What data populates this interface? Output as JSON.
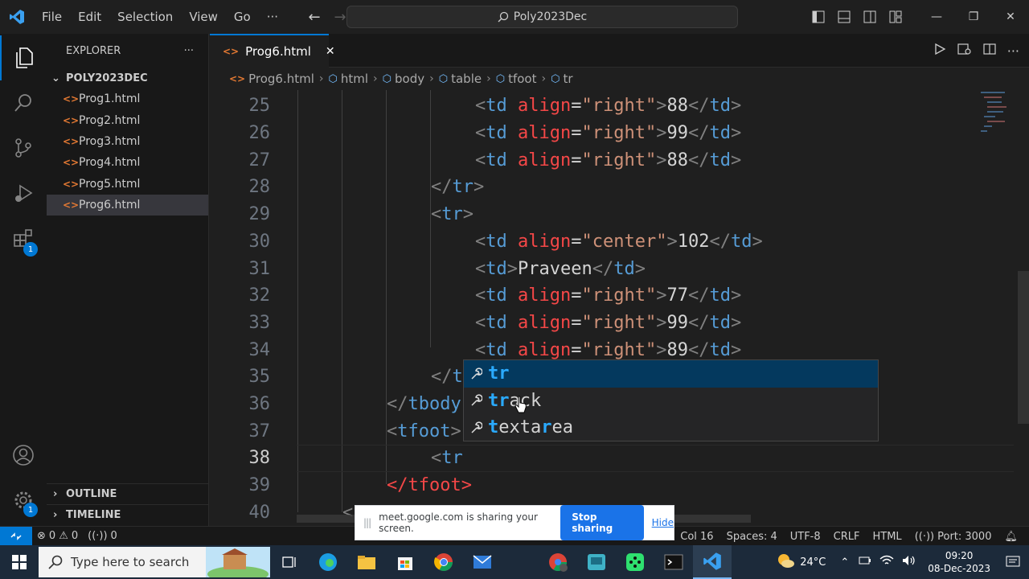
{
  "titlebar": {
    "menu": [
      "File",
      "Edit",
      "Selection",
      "View",
      "Go",
      "···"
    ],
    "search_text": "Poly2023Dec"
  },
  "sidebar": {
    "title": "EXPLORER",
    "more": "···",
    "folder": "POLY2023DEC",
    "files": [
      "Prog1.html",
      "Prog2.html",
      "Prog3.html",
      "Prog4.html",
      "Prog5.html",
      "Prog6.html"
    ],
    "selected_file": "Prog6.html",
    "outline": "OUTLINE",
    "timeline": "TIMELINE"
  },
  "activity": {
    "extensions_badge": "1",
    "settings_badge": "1"
  },
  "tab": {
    "label": "Prog6.html",
    "close": "✕"
  },
  "breadcrumb": [
    "Prog6.html",
    "html",
    "body",
    "table",
    "tfoot",
    "tr"
  ],
  "editor": {
    "lines": [
      {
        "n": "25"
      },
      {
        "n": "26"
      },
      {
        "n": "27"
      },
      {
        "n": "28"
      },
      {
        "n": "29"
      },
      {
        "n": "30"
      },
      {
        "n": "31"
      },
      {
        "n": "32"
      },
      {
        "n": "33"
      },
      {
        "n": "34"
      },
      {
        "n": "35"
      },
      {
        "n": "36"
      },
      {
        "n": "37"
      },
      {
        "n": "38"
      },
      {
        "n": "39"
      },
      {
        "n": "40"
      }
    ],
    "td": "td",
    "tr": "tr",
    "tbody": "tbody",
    "tfoot": "tfoot",
    "align": "align",
    "right": "\"right\"",
    "center": "\"center\"",
    "values": {
      "l25": "88",
      "l26": "99",
      "l27": "88",
      "l30": "102",
      "l31": "Praveen",
      "l32": "77",
      "l33": "99",
      "l34": "89"
    }
  },
  "suggest": {
    "items": [
      {
        "pre": "",
        "hl": "tr",
        "post": ""
      },
      {
        "pre": "",
        "hl": "tr",
        "post": "ack"
      },
      {
        "pre": "",
        "hl": "t",
        "post": "exta",
        "hl2": "r",
        "post2": "ea"
      }
    ]
  },
  "share_banner": {
    "message": "meet.google.com is sharing your screen.",
    "stop": "Stop sharing",
    "hide": "Hide"
  },
  "statusbar": {
    "errors": "0",
    "warnings": "0",
    "ports_count": "0",
    "position": "Col 16",
    "spaces": "Spaces: 4",
    "encoding": "UTF-8",
    "eol": "CRLF",
    "language": "HTML",
    "port": "Port: 3000"
  },
  "taskbar": {
    "search_placeholder": "Type here to search",
    "temperature": "24°C",
    "time": "09:20",
    "date": "08-Dec-2023"
  },
  "colors": {
    "accent": "#0078d4",
    "tag_name": "#569cd6",
    "attr_name": "#f44747",
    "attr_value": "#ce9178",
    "suggest_highlight": "#2aaaff"
  }
}
